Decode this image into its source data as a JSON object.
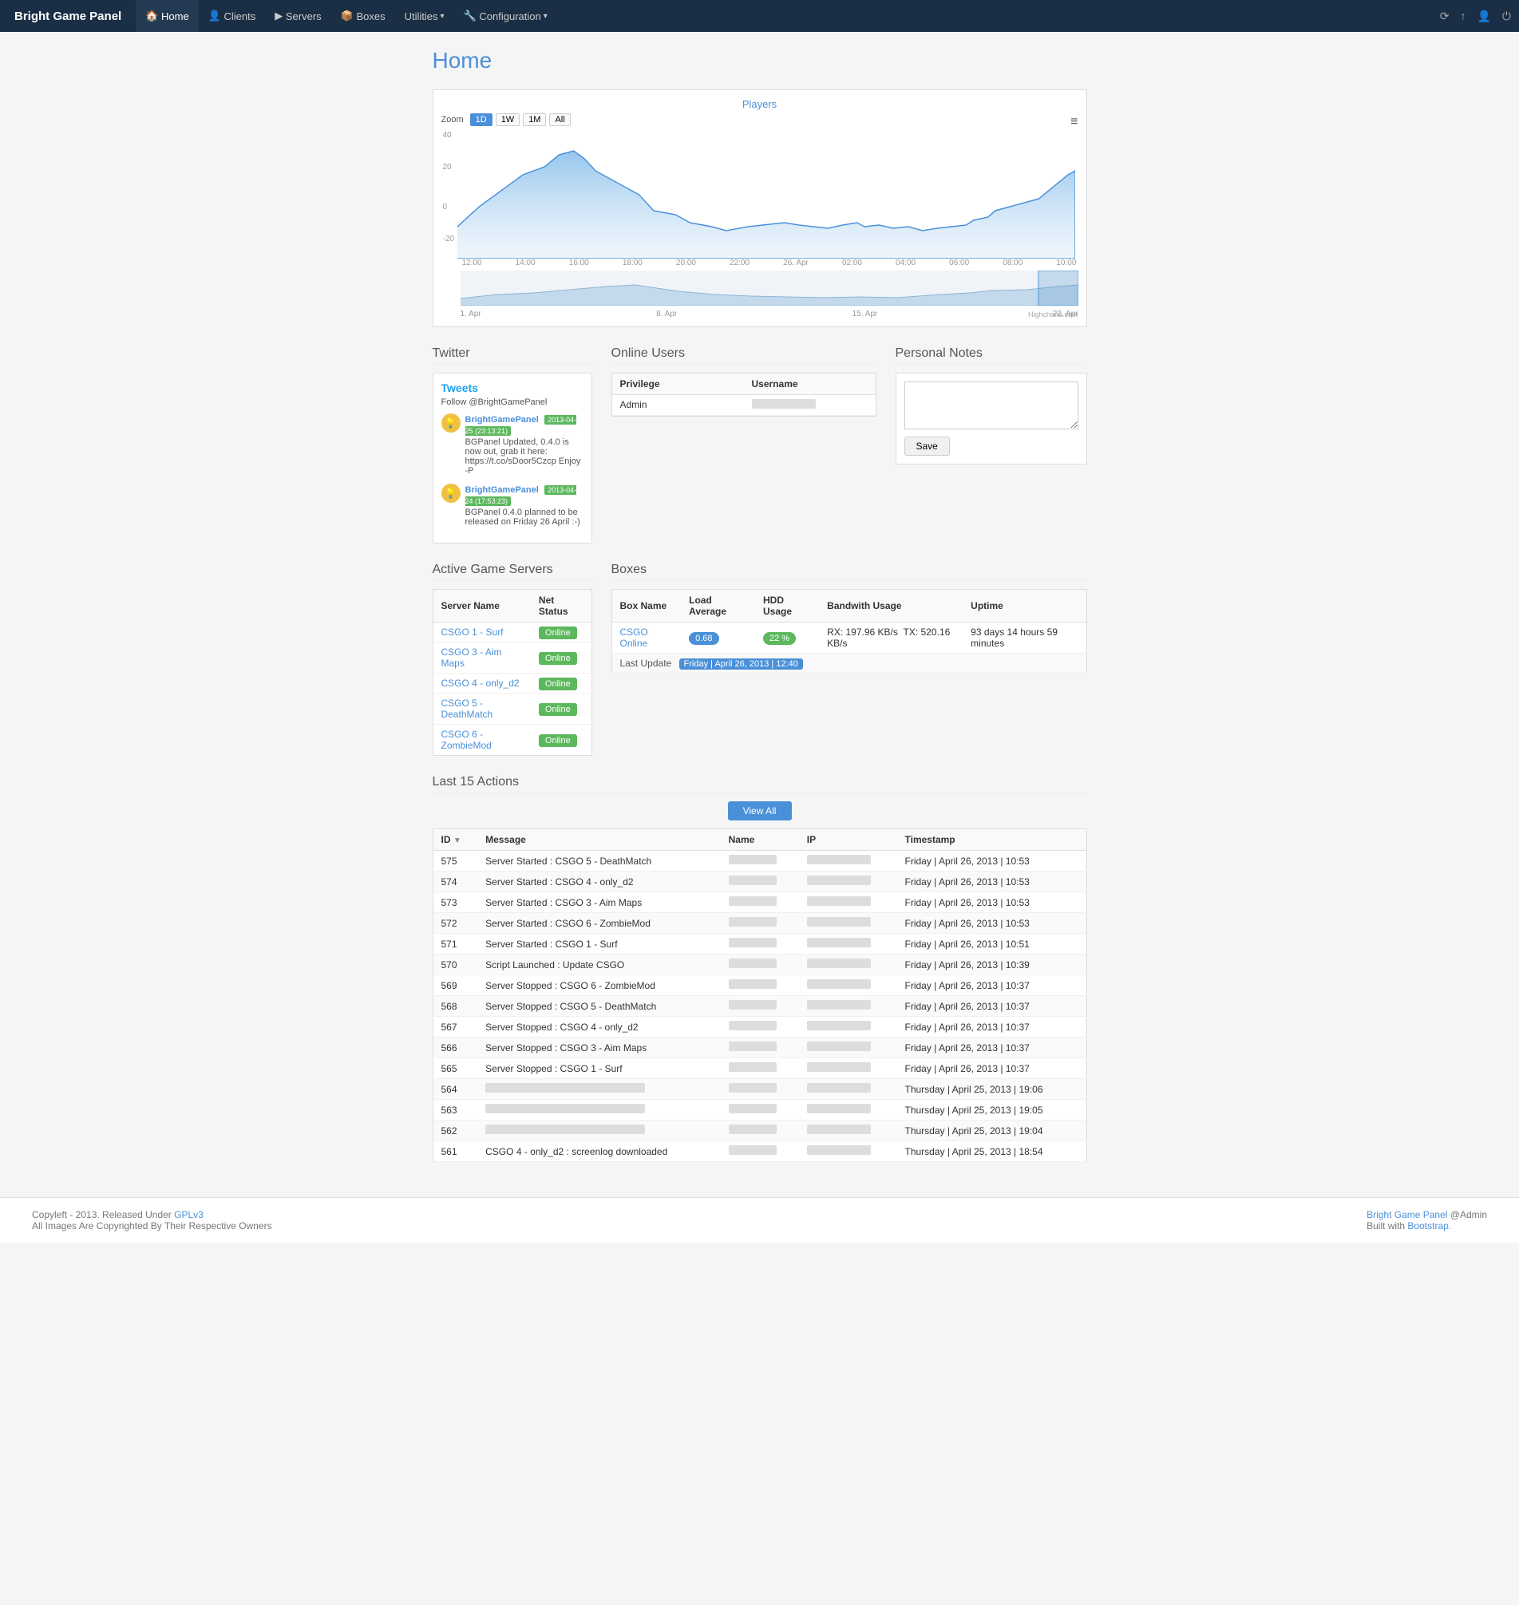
{
  "brand": "Bright Game Panel",
  "nav": {
    "items": [
      {
        "label": "Home",
        "icon": "🏠",
        "active": true
      },
      {
        "label": "Clients",
        "icon": "👤"
      },
      {
        "label": "Servers",
        "icon": "▶"
      },
      {
        "label": "Boxes",
        "icon": "📦"
      },
      {
        "label": "Utilities",
        "icon": "",
        "hasDropdown": true
      },
      {
        "label": "Configuration",
        "icon": "🔧",
        "hasDropdown": true
      }
    ]
  },
  "navbar_icons": [
    "⟳",
    "↑",
    "👤",
    "⏻"
  ],
  "page_title": "Home",
  "chart": {
    "title": "Players",
    "zoom_buttons": [
      "1D",
      "1W",
      "1M",
      "All"
    ],
    "active_zoom": "1D",
    "x_labels": [
      "12:00",
      "14:00",
      "16:00",
      "18:00",
      "20:00",
      "22:00",
      "26. Apr",
      "02:00",
      "04:00",
      "06:00",
      "08:00",
      "10:00"
    ],
    "nav_labels": [
      "1. Apr",
      "8. Apr",
      "15. Apr",
      "22. Apr"
    ],
    "y_labels": [
      "40",
      "20",
      "0",
      "-20"
    ],
    "credit": "Highcharts.com"
  },
  "twitter": {
    "title": "Twitter",
    "tweets_label": "Tweets",
    "follow_label": "Follow @BrightGamePanel",
    "tweets": [
      {
        "user": "BrightGamePanel",
        "date": "2013-04-25 (23:13:21)",
        "text": "BGPanel Updated, 0.4.0 is now out, grab it here: https://t.co/sDoor5Czcp Enjoy -P"
      },
      {
        "user": "BrightGamePanel",
        "date": "2013-04-24 (17:53:23)",
        "text": "BGPanel 0.4.0 planned to be released on Friday 26 April :-)"
      }
    ]
  },
  "online_users": {
    "title": "Online Users",
    "col_privilege": "Privilege",
    "col_username": "Username",
    "rows": [
      {
        "privilege": "Admin",
        "username": ""
      }
    ]
  },
  "personal_notes": {
    "title": "Personal Notes",
    "placeholder": "",
    "save_label": "Save"
  },
  "active_game_servers": {
    "title": "Active Game Servers",
    "col_server": "Server Name",
    "col_status": "Net Status",
    "rows": [
      {
        "name": "CSGO 1 - Surf",
        "status": "Online"
      },
      {
        "name": "CSGO 3 - Aim Maps",
        "status": "Online"
      },
      {
        "name": "CSGO 4 - only_d2",
        "status": "Online"
      },
      {
        "name": "CSGO 5 - DeathMatch",
        "status": "Online"
      },
      {
        "name": "CSGO 6 - ZombieMod",
        "status": "Online"
      }
    ]
  },
  "boxes": {
    "title": "Boxes",
    "col_name": "Box Name",
    "col_load": "Load Average",
    "col_hdd": "HDD Usage",
    "col_bandwidth": "Bandwith Usage",
    "col_uptime": "Uptime",
    "rows": [
      {
        "name": "CSGO Online",
        "load": "0.68",
        "hdd": "22 %",
        "bandwidth_rx": "RX: 197.96 KB/s",
        "bandwidth_tx": "TX: 520.16 KB/s",
        "uptime": "93 days 14 hours 59 minutes"
      }
    ],
    "last_update_label": "Last Update",
    "last_update_value": "Friday | April 26, 2013 | 12:40"
  },
  "actions": {
    "title": "Last 15 Actions",
    "view_all_label": "View All",
    "col_id": "ID",
    "col_message": "Message",
    "col_name": "Name",
    "col_ip": "IP",
    "col_timestamp": "Timestamp",
    "rows": [
      {
        "id": "575",
        "message": "Server Started : CSGO 5 - DeathMatch",
        "name": "",
        "ip": "",
        "timestamp": "Friday | April 26, 2013 | 10:53",
        "blurred": false
      },
      {
        "id": "574",
        "message": "Server Started : CSGO 4 - only_d2",
        "name": "",
        "ip": "",
        "timestamp": "Friday | April 26, 2013 | 10:53",
        "blurred": false
      },
      {
        "id": "573",
        "message": "Server Started : CSGO 3 - Aim Maps",
        "name": "",
        "ip": "",
        "timestamp": "Friday | April 26, 2013 | 10:53",
        "blurred": false
      },
      {
        "id": "572",
        "message": "Server Started : CSGO 6 - ZombieMod",
        "name": "",
        "ip": "",
        "timestamp": "Friday | April 26, 2013 | 10:53",
        "blurred": false
      },
      {
        "id": "571",
        "message": "Server Started : CSGO 1 - Surf",
        "name": "",
        "ip": "",
        "timestamp": "Friday | April 26, 2013 | 10:51",
        "blurred": false
      },
      {
        "id": "570",
        "message": "Script Launched : Update CSGO",
        "name": "",
        "ip": "",
        "timestamp": "Friday | April 26, 2013 | 10:39",
        "blurred": false
      },
      {
        "id": "569",
        "message": "Server Stopped : CSGO 6 - ZombieMod",
        "name": "",
        "ip": "",
        "timestamp": "Friday | April 26, 2013 | 10:37",
        "blurred": false
      },
      {
        "id": "568",
        "message": "Server Stopped : CSGO 5 - DeathMatch",
        "name": "",
        "ip": "",
        "timestamp": "Friday | April 26, 2013 | 10:37",
        "blurred": false
      },
      {
        "id": "567",
        "message": "Server Stopped : CSGO 4 - only_d2",
        "name": "",
        "ip": "",
        "timestamp": "Friday | April 26, 2013 | 10:37",
        "blurred": false
      },
      {
        "id": "566",
        "message": "Server Stopped : CSGO 3 - Aim Maps",
        "name": "",
        "ip": "",
        "timestamp": "Friday | April 26, 2013 | 10:37",
        "blurred": false
      },
      {
        "id": "565",
        "message": "Server Stopped : CSGO 1 - Surf",
        "name": "",
        "ip": "",
        "timestamp": "Friday | April 26, 2013 | 10:37",
        "blurred": false
      },
      {
        "id": "564",
        "message": "",
        "name": "",
        "ip": "",
        "timestamp": "Thursday | April 25, 2013 | 19:06",
        "blurred": true
      },
      {
        "id": "563",
        "message": "",
        "name": "",
        "ip": "",
        "timestamp": "Thursday | April 25, 2013 | 19:05",
        "blurred": true
      },
      {
        "id": "562",
        "message": "",
        "name": "",
        "ip": "",
        "timestamp": "Thursday | April 25, 2013 | 19:04",
        "blurred": true
      },
      {
        "id": "561",
        "message": "CSGO 4 - only_d2 : screenlog downloaded",
        "name": "",
        "ip": "",
        "timestamp": "Thursday | April 25, 2013 | 18:54",
        "blurred": false
      }
    ]
  },
  "footer": {
    "copy": "Copyleft - 2013. Released Under ",
    "license": "GPLv3",
    "copy2": "All Images Are Copyrighted By Their Respective Owners",
    "brand_link": "Bright Game Panel",
    "admin": "@Admin",
    "built": "Built with ",
    "bootstrap": "Bootstrap."
  }
}
